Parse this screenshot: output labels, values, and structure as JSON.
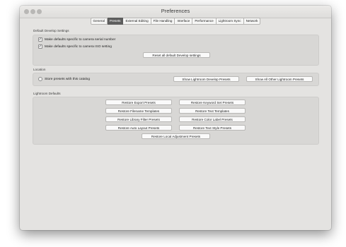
{
  "window": {
    "title": "Preferences"
  },
  "tabs": [
    {
      "label": "General",
      "active": false
    },
    {
      "label": "Presets",
      "active": true
    },
    {
      "label": "External Editing",
      "active": false
    },
    {
      "label": "File Handling",
      "active": false
    },
    {
      "label": "Interface",
      "active": false
    },
    {
      "label": "Performance",
      "active": false
    },
    {
      "label": "Lightroom Sync",
      "active": false
    },
    {
      "label": "Network",
      "active": false
    }
  ],
  "develop_defaults": {
    "heading": "Default Develop Settings",
    "serial_checkbox": {
      "label": "Make defaults specific to camera serial number",
      "checked": true
    },
    "iso_checkbox": {
      "label": "Make defaults specific to camera ISO setting",
      "checked": true
    },
    "reset_button": "Reset all default Develop settings"
  },
  "location": {
    "heading": "Location",
    "store_presets": {
      "label": "Store presets with this catalog",
      "checked": false
    },
    "show_develop_button": "Show Lightroom Develop Presets",
    "show_other_button": "Show All Other Lightroom Presets"
  },
  "lightroom_defaults": {
    "heading": "Lightroom Defaults",
    "buttons": {
      "export_presets": "Restore Export Presets",
      "keyword_set_presets": "Restore Keyword Set Presets",
      "filename_templates": "Restore Filename Templates",
      "text_templates": "Restore Text Templates",
      "library_filter_presets": "Restore Library Filter Presets",
      "color_label_presets": "Restore Color Label Presets",
      "auto_layout_presets": "Restore Auto Layout Presets",
      "text_style_presets": "Restore Text Style Presets",
      "local_adjustment_presets": "Restore Local Adjustment Presets"
    }
  },
  "icons": {
    "traffic_lights": [
      "close-icon",
      "minimize-icon",
      "zoom-icon"
    ],
    "checkmark": "✓"
  },
  "colors": {
    "active_tab": "#5d5d5d",
    "window_bg": "#e4e3e1",
    "group_bg": "#d8d7d5"
  }
}
